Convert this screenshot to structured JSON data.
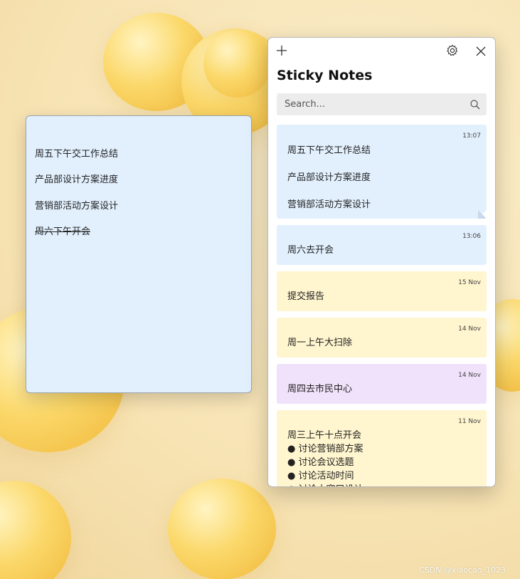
{
  "open_note": {
    "lines": [
      {
        "text": "周五下午交工作总结",
        "strike": false
      },
      {
        "text": "产品部设计方案进度",
        "strike": false
      },
      {
        "text": "营销部活动方案设计",
        "strike": false
      },
      {
        "text": "周六下午开会",
        "strike": true
      }
    ],
    "color": "#e2f0fe"
  },
  "panel": {
    "title": "Sticky Notes",
    "search_placeholder": "Search...",
    "add_icon": "plus-icon",
    "settings_icon": "gear-icon",
    "close_icon": "close-icon"
  },
  "notes": [
    {
      "time": "13:07",
      "color": "#e2f0fe",
      "lines": [
        "周五下午交工作总结",
        "产品部设计方案进度",
        "营销部活动方案设计"
      ]
    },
    {
      "time": "13:06",
      "color": "#e2f0fe",
      "lines": [
        "周六去开会"
      ]
    },
    {
      "time": "15 Nov",
      "color": "#fff5cf",
      "lines": [
        "提交报告"
      ]
    },
    {
      "time": "14 Nov",
      "color": "#fff5cf",
      "lines": [
        "周一上午大扫除"
      ]
    },
    {
      "time": "14 Nov",
      "color": "#f1e2fb",
      "lines": [
        "周四去市民中心"
      ]
    },
    {
      "time": "11 Nov",
      "color": "#fff5cf",
      "lines": [
        "周三上午十点开会",
        "● 讨论营销部方案",
        "● 讨论会议选题",
        "● 讨论活动时间",
        "● 讨论小窗口设计"
      ]
    }
  ],
  "watermark": "CSDN @xiaocao_1023"
}
